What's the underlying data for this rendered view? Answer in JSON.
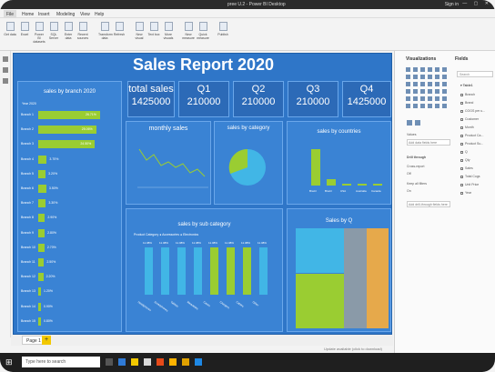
{
  "window": {
    "title": "pree U.2 - Power BI Desktop",
    "signin": "Sign in"
  },
  "menu": {
    "items": [
      "File",
      "Home",
      "Insert",
      "Modeling",
      "View",
      "Help"
    ]
  },
  "ribbon": {
    "buttons": [
      "Get data",
      "Excel",
      "Power BI datasets",
      "SQL Server",
      "Enter data",
      "Recent sources",
      "Transform data",
      "Refresh",
      "New visual",
      "Text box",
      "More visuals",
      "New measure",
      "Quick measure",
      "Publish"
    ]
  },
  "report": {
    "title": "Sales Report 2020",
    "kpis": [
      {
        "label": "total sales",
        "value": "1425000"
      },
      {
        "label": "Q1",
        "value": "210000"
      },
      {
        "label": "Q2",
        "value": "210000"
      },
      {
        "label": "Q3",
        "value": "210000"
      },
      {
        "label": "Q4",
        "value": "1425000"
      }
    ],
    "branch": {
      "title": "sales by branch 2020",
      "legend": "Year 2020",
      "rows": [
        {
          "label": "Branch 1",
          "value": 26.71,
          "display": "26.71%"
        },
        {
          "label": "Branch 2",
          "value": 25.06,
          "display": "25.06%"
        },
        {
          "label": "Branch 3",
          "value": 24.5,
          "display": "24.50%"
        },
        {
          "label": "Branch 4",
          "value": 3.7,
          "display": "3.70%"
        },
        {
          "label": "Branch 5",
          "value": 3.2,
          "display": "3.20%"
        },
        {
          "label": "Branch 6",
          "value": 3.5,
          "display": "3.50%"
        },
        {
          "label": "Branch 7",
          "value": 3.3,
          "display": "3.30%"
        },
        {
          "label": "Branch 8",
          "value": 2.9,
          "display": "2.90%"
        },
        {
          "label": "Branch 9",
          "value": 2.8,
          "display": "2.80%"
        },
        {
          "label": "Branch 10",
          "value": 2.7,
          "display": "2.70%"
        },
        {
          "label": "Branch 11",
          "value": 2.5,
          "display": "2.50%"
        },
        {
          "label": "Branch 12",
          "value": 2.2,
          "display": "2.20%"
        },
        {
          "label": "Branch 13",
          "value": 1.2,
          "display": "1.20%"
        },
        {
          "label": "Branch 14",
          "value": 0.9,
          "display": "0.90%"
        },
        {
          "label": "Branch 15",
          "value": 0.8,
          "display": "0.80%"
        }
      ]
    },
    "monthly": {
      "title": "monthly sales"
    },
    "category": {
      "title": "sales by category",
      "slices": [
        {
          "name": "Accessories",
          "value": 40,
          "color": "#9acd32"
        },
        {
          "name": "Electronics",
          "value": 60,
          "color": "#41b6e6"
        }
      ]
    },
    "countries": {
      "title": "sales by countries",
      "bars": [
        {
          "label": "Brazil",
          "value": 72.6
        },
        {
          "label": "Brazil",
          "value": 12.0
        },
        {
          "label": "USA",
          "value": 2.6
        },
        {
          "label": "Australia",
          "value": 1.8
        },
        {
          "label": "Canada",
          "value": 1.5
        }
      ]
    },
    "subcategory": {
      "title": "sales by sub category",
      "legend_label": "Product Category",
      "legend_items": [
        "Accessories",
        "Electronics"
      ],
      "bars": [
        {
          "label": "Headphones",
          "value": 11.08,
          "color": "#41b6e6"
        },
        {
          "label": "Smartphones",
          "value": 11.08,
          "color": "#41b6e6"
        },
        {
          "label": "Tablets",
          "value": 11.08,
          "color": "#41b6e6"
        },
        {
          "label": "Wearables",
          "value": 11.08,
          "color": "#41b6e6"
        },
        {
          "label": "Cases",
          "value": 11.08,
          "color": "#9acd32"
        },
        {
          "label": "Chargers",
          "value": 11.08,
          "color": "#9acd32"
        },
        {
          "label": "Cables",
          "value": 11.08,
          "color": "#9acd32"
        },
        {
          "label": "Other",
          "value": 11.08,
          "color": "#41b6e6"
        }
      ]
    },
    "byq": {
      "title": "Sales by Q"
    }
  },
  "page": {
    "tab": "Page 1"
  },
  "taskbar": {
    "search": "Type here to search"
  },
  "panes": {
    "viz_title": "Visualizations",
    "fields_title": "Fields",
    "search": "Search",
    "values_label": "Values",
    "values_placeholder": "Add data fields here",
    "drill": "Drill through",
    "cross_report": "Cross-report",
    "off": "Off",
    "keep_filters": "Keep all filters",
    "on": "On",
    "add_drill": "Add drill-through fields here",
    "table": "Table1",
    "fields": [
      "Branch",
      "Brand",
      "COGS per u...",
      "Customer",
      "Month",
      "Product Ca...",
      "Product Su...",
      "Q",
      "Qty",
      "Sales",
      "Total Cogs",
      "Unit Price",
      "Year"
    ]
  },
  "status": {
    "text": "Update available (click to download)"
  }
}
